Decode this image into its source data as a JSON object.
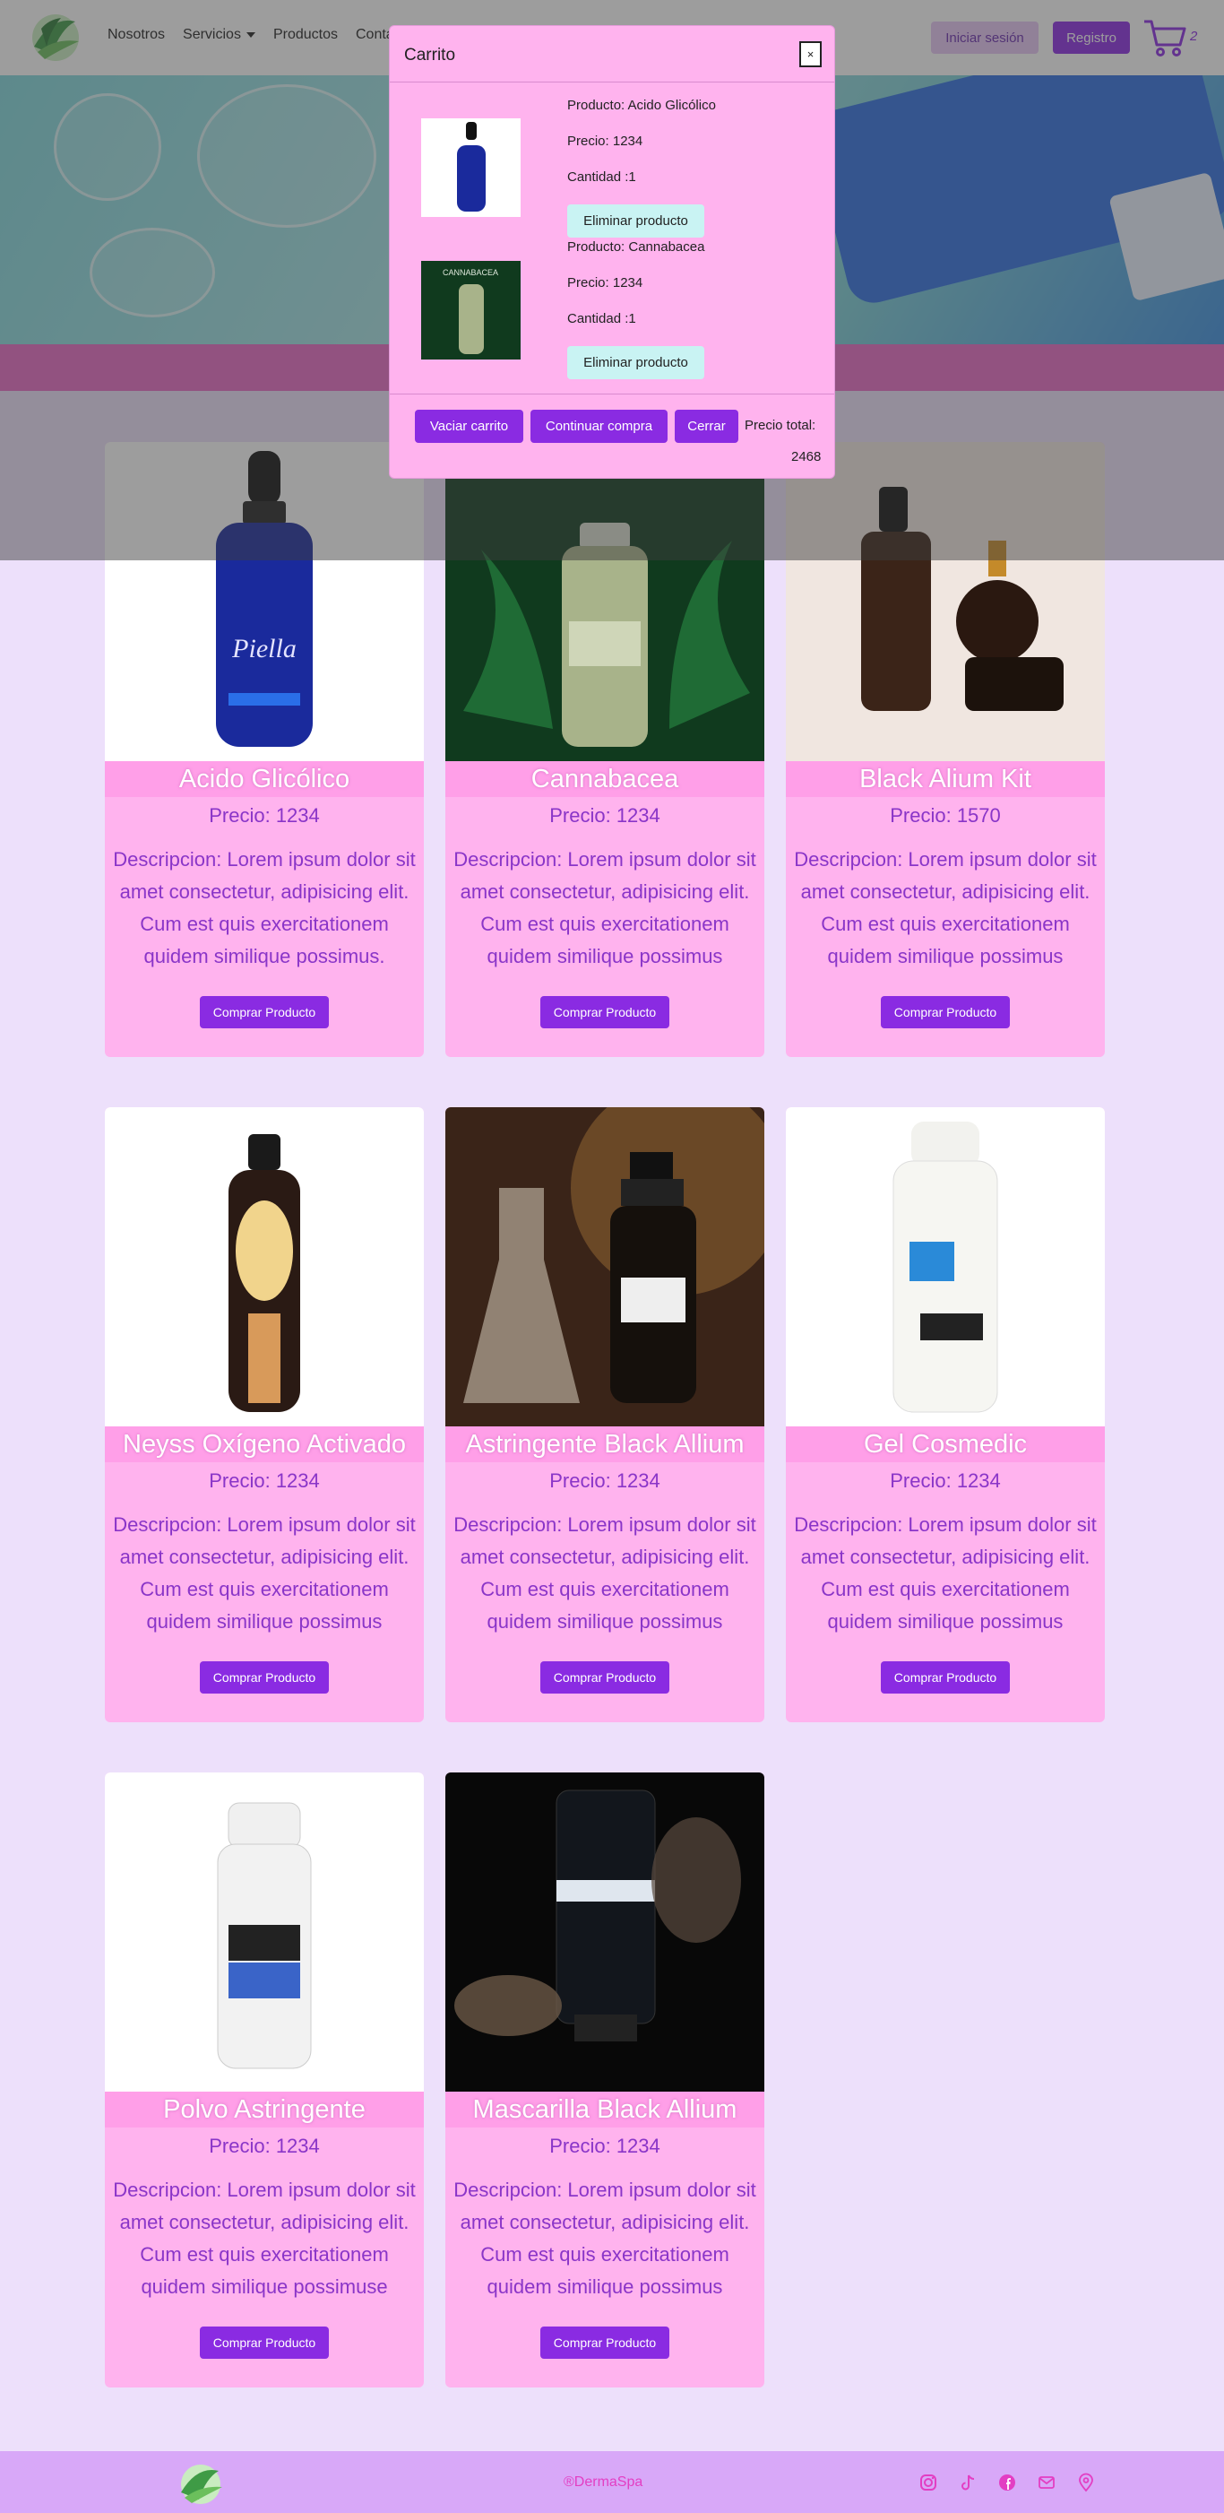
{
  "nav": {
    "links": [
      "Nosotros",
      "Servicios",
      "Productos",
      "Conta"
    ],
    "login_label": "Iniciar sesión",
    "register_label": "Registro",
    "cart_count": "2"
  },
  "modal": {
    "title": "Carrito",
    "close_label": "×",
    "items": [
      {
        "product": "Producto: Acido Glicólico",
        "price": "Precio: 1234",
        "qty": "Cantidad :1",
        "remove": "Eliminar producto"
      },
      {
        "product": "Producto: Cannabacea",
        "price": "Precio: 1234",
        "qty": "Cantidad :1",
        "remove": "Eliminar producto"
      }
    ],
    "empty_label": "Vaciar carrito",
    "continue_label": "Continuar compra",
    "close_button_label": "Cerrar",
    "total_label": "Precio total:",
    "total_value": "2468"
  },
  "products": [
    {
      "name": "Acido Glicólico",
      "price": "Precio: 1234",
      "desc": "Descripcion: Lorem ipsum dolor sit amet consectetur, adipisicing elit. Cum est quis exercitationem quidem similique possimus.",
      "button": "Comprar Producto"
    },
    {
      "name": "Cannabacea",
      "price": "Precio: 1234",
      "desc": "Descripcion: Lorem ipsum dolor sit amet consectetur, adipisicing elit. Cum est quis exercitationem quidem similique possimus",
      "button": "Comprar Producto"
    },
    {
      "name": "Black Alium Kit",
      "price": "Precio: 1570",
      "desc": "Descripcion: Lorem ipsum dolor sit amet consectetur, adipisicing elit. Cum est quis exercitationem quidem similique possimus",
      "button": "Comprar Producto"
    },
    {
      "name": "Neyss Oxígeno Activado",
      "price": "Precio: 1234",
      "desc": "Descripcion: Lorem ipsum dolor sit amet consectetur, adipisicing elit. Cum est quis exercitationem quidem similique possimus",
      "button": "Comprar Producto"
    },
    {
      "name": "Astringente Black Allium",
      "price": "Precio: 1234",
      "desc": "Descripcion: Lorem ipsum dolor sit amet consectetur, adipisicing elit. Cum est quis exercitationem quidem similique possimus",
      "button": "Comprar Producto"
    },
    {
      "name": "Gel Cosmedic",
      "price": "Precio: 1234",
      "desc": "Descripcion: Lorem ipsum dolor sit amet consectetur, adipisicing elit. Cum est quis exercitationem quidem similique possimus",
      "button": "Comprar Producto"
    },
    {
      "name": "Polvo Astringente",
      "price": "Precio: 1234",
      "desc": "Descripcion: Lorem ipsum dolor sit amet consectetur, adipisicing elit. Cum est quis exercitationem quidem similique possimuse",
      "button": "Comprar Producto"
    },
    {
      "name": "Mascarilla Black Allium",
      "price": "Precio: 1234",
      "desc": "Descripcion: Lorem ipsum dolor sit amet consectetur, adipisicing elit. Cum est quis exercitationem quidem similique possimus",
      "button": "Comprar Producto"
    }
  ],
  "footer": {
    "copyright": "®DermaSpa",
    "icons": [
      "instagram-icon",
      "tiktok-icon",
      "facebook-icon",
      "email-icon",
      "location-icon"
    ]
  },
  "colors": {
    "accent": "#8a2be2",
    "card": "#ffb3ee",
    "page": "#ede0fb",
    "footer": "#d8a8f8"
  }
}
